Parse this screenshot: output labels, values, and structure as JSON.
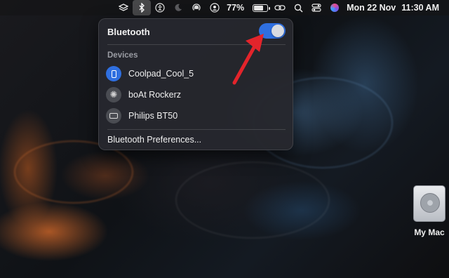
{
  "menubar": {
    "icons": [
      "layers-icon",
      "bluetooth-icon",
      "accessibility-icon",
      "moon-icon",
      "airplay-icon",
      "user-icon"
    ],
    "battery_percent": "77%",
    "battery_level": 0.77,
    "date": "Mon 22 Nov",
    "time": "11:30 AM"
  },
  "bluetooth_panel": {
    "title": "Bluetooth",
    "toggle_on": true,
    "devices_label": "Devices",
    "devices": [
      {
        "name": "Coolpad_Cool_5",
        "icon": "phone-icon"
      },
      {
        "name": "boAt Rockerz",
        "icon": "spinner-icon"
      },
      {
        "name": "Philips BT50",
        "icon": "keyboard-icon"
      }
    ],
    "preferences_label": "Bluetooth Preferences..."
  },
  "desktop": {
    "drive_label": "My Mac"
  },
  "colors": {
    "toggle_accent": "#2f6fe0",
    "arrow": "#e3242b"
  }
}
